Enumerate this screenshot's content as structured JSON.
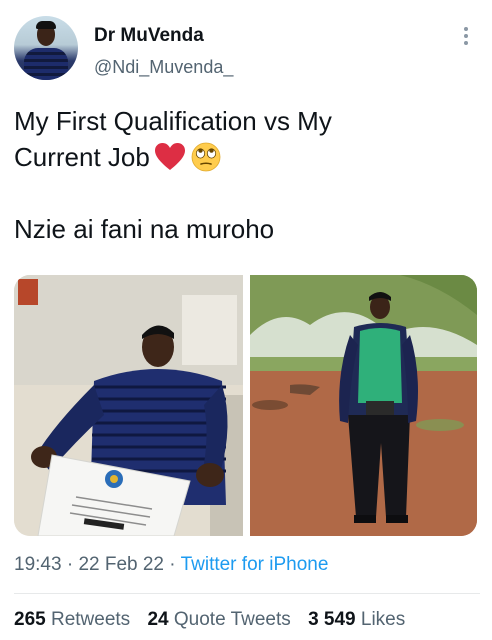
{
  "tweet": {
    "author": {
      "display_name": "Dr MuVenda",
      "handle": "@Ndi_Muvenda_"
    },
    "text": {
      "line1": "My First Qualification vs My",
      "line2": "Current Job",
      "line3": "Nzie ai fani na muroho"
    },
    "emojis": [
      "red-heart",
      "face-with-rolling-eyes"
    ],
    "media": [
      {
        "description": "photo-graduate-with-certificate"
      },
      {
        "description": "photo-worker-in-green-vest"
      }
    ],
    "meta": {
      "time": "19:43",
      "date": "22 Feb 22",
      "separator": "·",
      "source": "Twitter for iPhone"
    },
    "stats": {
      "retweets": {
        "count": "265",
        "label": "Retweets"
      },
      "quote_tweets": {
        "count": "24",
        "label": "Quote Tweets"
      },
      "likes": {
        "count": "3 549",
        "label": "Likes"
      }
    }
  },
  "colors": {
    "link": "#1d9bf0",
    "secondary_text": "#536471",
    "primary_text": "#0f1419",
    "divider": "#e7e9ea"
  }
}
